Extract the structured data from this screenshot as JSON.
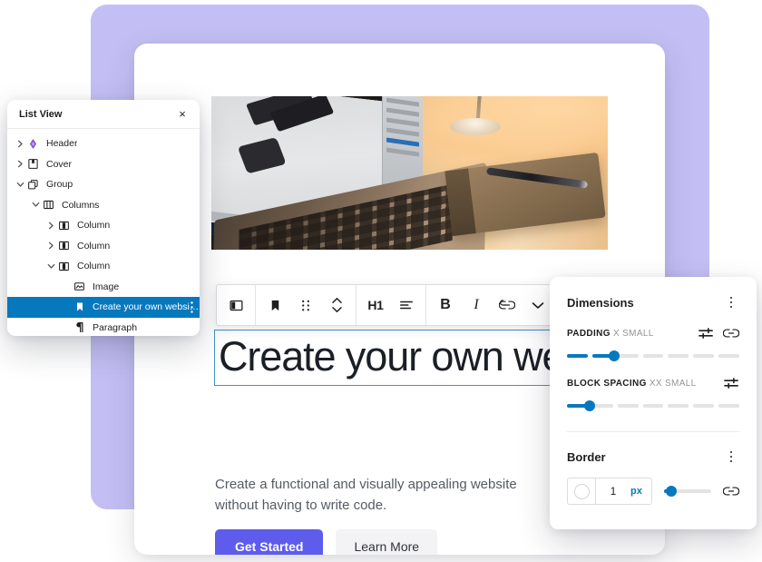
{
  "canvas": {
    "hero": {
      "heading": "Create your own website",
      "subtext": "Create a functional and visually appealing website without having to write code.",
      "primary_button": "Get Started",
      "secondary_button": "Learn More",
      "image_alt": "laptop-on-desk-photo",
      "primary_button_color": "#5d5cec",
      "selection_outline_color": "#3f93c9"
    },
    "backdrop_color": "#c3bff4",
    "card_color": "#ffffff"
  },
  "block_toolbar": {
    "buttons": [
      {
        "name": "block-type-columns",
        "icon": "columns-icon",
        "label": ""
      },
      {
        "name": "block-type-heading",
        "icon": "bookmark-icon",
        "label": ""
      },
      {
        "name": "drag-handle",
        "icon": "drag-dots-icon",
        "label": ""
      },
      {
        "name": "move-up-down",
        "icon": "chevron-up-down-icon",
        "label": ""
      },
      {
        "name": "heading-level",
        "icon": "text-icon",
        "label": "H1"
      },
      {
        "name": "align-text",
        "icon": "align-left-icon",
        "label": ""
      },
      {
        "name": "bold",
        "icon": "bold-icon",
        "label": "B"
      },
      {
        "name": "italic",
        "icon": "italic-icon",
        "label": "I"
      },
      {
        "name": "link",
        "icon": "link-icon",
        "label": ""
      },
      {
        "name": "more-rich-text",
        "icon": "chevron-down-icon",
        "label": ""
      },
      {
        "name": "block-options",
        "icon": "kebab-icon",
        "label": ""
      }
    ]
  },
  "list_view": {
    "title": "List View",
    "close_label": "×",
    "selected_color": "#0678be",
    "rows": [
      {
        "label": "Header",
        "icon": "header-block-icon",
        "chevron": "right",
        "indent": 0,
        "selected": false,
        "has_more": false
      },
      {
        "label": "Cover",
        "icon": "cover-block-icon",
        "chevron": "right",
        "indent": 0,
        "selected": false,
        "has_more": false
      },
      {
        "label": "Group",
        "icon": "group-block-icon",
        "chevron": "down",
        "indent": 0,
        "selected": false,
        "has_more": false
      },
      {
        "label": "Columns",
        "icon": "columns-block-icon",
        "chevron": "down",
        "indent": 1,
        "selected": false,
        "has_more": false
      },
      {
        "label": "Column",
        "icon": "column-block-icon",
        "chevron": "right",
        "indent": 2,
        "selected": false,
        "has_more": false
      },
      {
        "label": "Column",
        "icon": "column-block-icon",
        "chevron": "right",
        "indent": 2,
        "selected": false,
        "has_more": false
      },
      {
        "label": "Column",
        "icon": "column-block-icon",
        "chevron": "down",
        "indent": 2,
        "selected": false,
        "has_more": false
      },
      {
        "label": "Image",
        "icon": "image-block-icon",
        "chevron": "none",
        "indent": 3,
        "selected": false,
        "has_more": false
      },
      {
        "label": "Create your own websi…",
        "icon": "heading-block-icon",
        "chevron": "none",
        "indent": 3,
        "selected": true,
        "has_more": true
      },
      {
        "label": "Paragraph",
        "icon": "paragraph-block-icon",
        "chevron": "none",
        "indent": 3,
        "selected": false,
        "has_more": false
      }
    ]
  },
  "dimensions_panel": {
    "title": "Dimensions",
    "accent_color": "#0678be",
    "padding": {
      "label": "PADDING",
      "value_label": "X SMALL",
      "segments": 7,
      "filled": 2,
      "tools_icon": "sliders-icon",
      "link_icon": "link-sides-icon"
    },
    "block_spacing": {
      "label": "BLOCK SPACING",
      "value_label": "XX SMALL",
      "segments": 7,
      "filled": 1,
      "tools_icon": "sliders-icon"
    },
    "border": {
      "title": "Border",
      "color_swatch": "#ffffff",
      "width_value": "1",
      "unit": "px",
      "unit_color": "#0678be",
      "slider_percent": 3,
      "link_icon": "link-sides-icon"
    }
  }
}
